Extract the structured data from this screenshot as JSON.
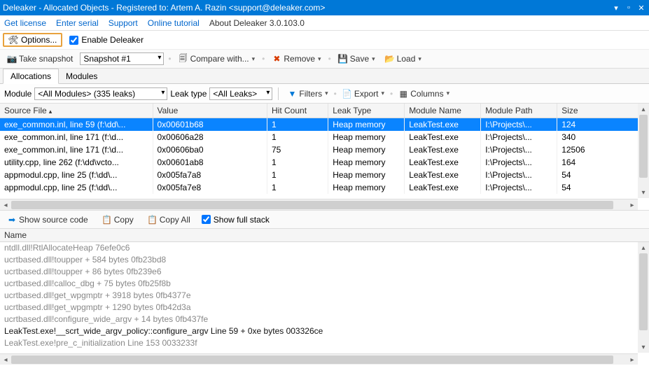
{
  "title": "Deleaker - Allocated Objects - Registered to: Artem A. Razin <support@deleaker.com>",
  "menubar": {
    "get_license": "Get license",
    "enter_serial": "Enter serial",
    "support": "Support",
    "online_tutorial": "Online tutorial",
    "about": "About Deleaker 3.0.103.0"
  },
  "options": {
    "button": "Options...",
    "enable": "Enable Deleaker"
  },
  "toolbar": {
    "take_snapshot": "Take snapshot",
    "snapshot": "Snapshot #1",
    "compare": "Compare with...",
    "remove": "Remove",
    "save": "Save",
    "load": "Load"
  },
  "tabs": {
    "allocations": "Allocations",
    "modules": "Modules"
  },
  "filters": {
    "module_lbl": "Module",
    "module_dd": "<All Modules>  (335 leaks)",
    "leak_type_lbl": "Leak type",
    "leak_type_dd": "<All Leaks>",
    "filters": "Filters",
    "export": "Export",
    "columns": "Columns"
  },
  "grid": {
    "headers": [
      "Source File",
      "Value",
      "Hit Count",
      "Leak Type",
      "Module Name",
      "Module Path",
      "Size"
    ],
    "rows": [
      {
        "src": "exe_common.inl, line 59 (f:\\dd\\...",
        "val": "0x00601b68",
        "hit": "1",
        "leak": "Heap memory",
        "mod": "LeakTest.exe",
        "path": "I:\\Projects\\...",
        "size": "124"
      },
      {
        "src": "exe_common.inl, line 171 (f:\\d...",
        "val": "0x00606a28",
        "hit": "1",
        "leak": "Heap memory",
        "mod": "LeakTest.exe",
        "path": "I:\\Projects\\...",
        "size": "340"
      },
      {
        "src": "exe_common.inl, line 171 (f:\\d...",
        "val": "0x00606ba0",
        "hit": "75",
        "leak": "Heap memory",
        "mod": "LeakTest.exe",
        "path": "I:\\Projects\\...",
        "size": "12506"
      },
      {
        "src": "utility.cpp, line 262 (f:\\dd\\vcto...",
        "val": "0x00601ab8",
        "hit": "1",
        "leak": "Heap memory",
        "mod": "LeakTest.exe",
        "path": "I:\\Projects\\...",
        "size": "164"
      },
      {
        "src": "appmodul.cpp, line 25 (f:\\dd\\...",
        "val": "0x005fa7a8",
        "hit": "1",
        "leak": "Heap memory",
        "mod": "LeakTest.exe",
        "path": "I:\\Projects\\...",
        "size": "54"
      },
      {
        "src": "appmodul.cpp, line 25 (f:\\dd\\...",
        "val": "0x005fa7e8",
        "hit": "1",
        "leak": "Heap memory",
        "mod": "LeakTest.exe",
        "path": "I:\\Projects\\...",
        "size": "54"
      }
    ]
  },
  "mid": {
    "show_source": "Show source code",
    "copy": "Copy",
    "copy_all": "Copy All",
    "show_full": "Show full stack"
  },
  "stack": {
    "header": "Name",
    "items": [
      "ntdll.dll!RtlAllocateHeap 76efe0c6",
      "ucrtbased.dll!toupper + 584 bytes 0fb23bd8",
      "ucrtbased.dll!toupper + 86 bytes 0fb239e6",
      "ucrtbased.dll!calloc_dbg + 75 bytes 0fb25f8b",
      "ucrtbased.dll!get_wpgmptr + 3918 bytes 0fb4377e",
      "ucrtbased.dll!get_wpgmptr + 1290 bytes 0fb42d3a",
      "ucrtbased.dll!configure_wide_argv + 14 bytes 0fb437fe",
      "LeakTest.exe!__scrt_wide_argv_policy::configure_argv Line 59 + 0xe bytes 003326ce",
      "LeakTest.exe!pre_c_initialization Line 153 0033233f"
    ],
    "active_index": 7
  }
}
